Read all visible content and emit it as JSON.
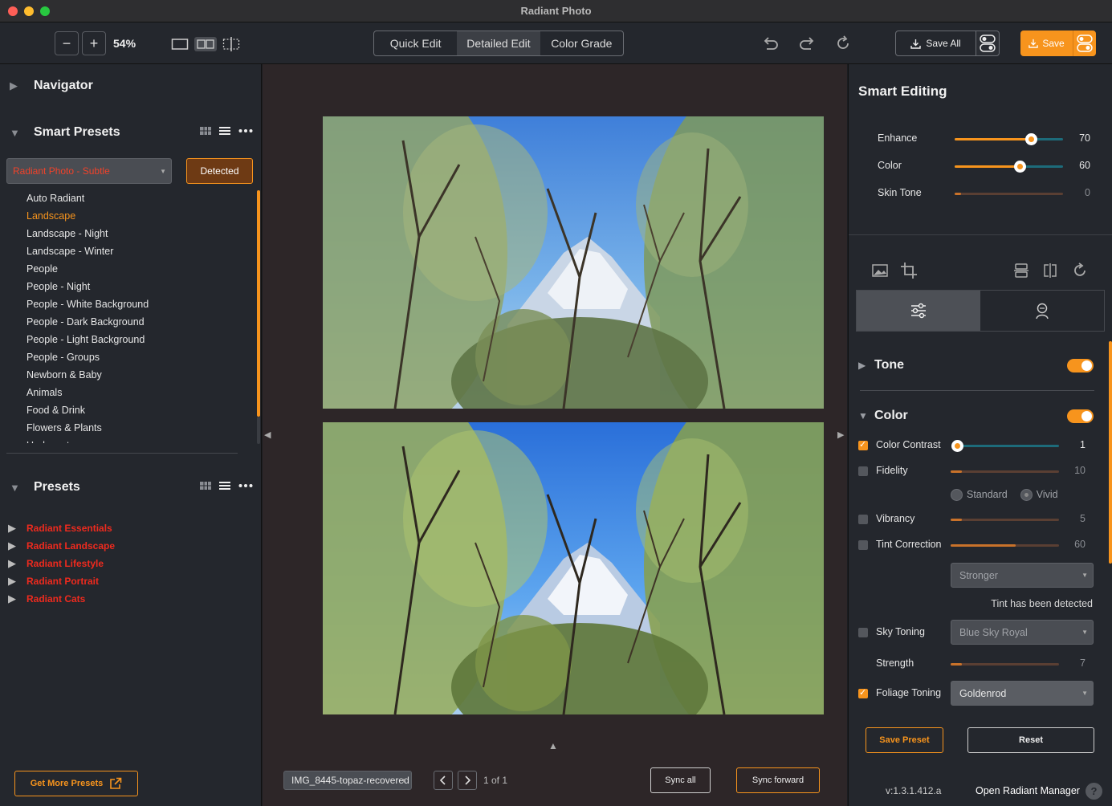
{
  "window": {
    "title": "Radiant Photo"
  },
  "toolbar": {
    "zoom_minus": "−",
    "zoom_plus": "+",
    "zoom": "54%",
    "modes": [
      "Quick Edit",
      "Detailed Edit",
      "Color Grade"
    ],
    "active_mode": "Detailed Edit",
    "save_all": "Save All",
    "save": "Save"
  },
  "left": {
    "navigator": "Navigator",
    "smart_presets": "Smart Presets",
    "selected_preset": "Radiant Photo - Subtle",
    "detected": "Detected",
    "smart_list": [
      "Auto Radiant",
      "Landscape",
      "Landscape - Night",
      "Landscape - Winter",
      "People",
      "People - Night",
      "People - White Background",
      "People - Dark Background",
      "People - Light Background",
      "People - Groups",
      "Newborn & Baby",
      "Animals",
      "Food & Drink",
      "Flowers & Plants",
      "Underwater"
    ],
    "presets": "Presets",
    "folders": [
      "Radiant Essentials",
      "Radiant Landscape",
      "Radiant Lifestyle",
      "Radiant Portrait",
      "Radiant Cats"
    ],
    "get_more": "Get More Presets"
  },
  "center": {
    "file_name": "IMG_8445-topaz-recovered",
    "page": "1 of 1",
    "sync_all": "Sync all",
    "sync_forward": "Sync forward"
  },
  "right": {
    "title": "Smart Editing",
    "smart_sliders": [
      {
        "label": "Enhance",
        "value": "70",
        "level": 0.7
      },
      {
        "label": "Color",
        "value": "60",
        "level": 0.6
      },
      {
        "label": "Skin Tone",
        "value": "0",
        "level": 0.0
      }
    ],
    "tone": "Tone",
    "color": "Color",
    "color_contrast": {
      "label": "Color Contrast",
      "value": "1",
      "level": 0.01
    },
    "fidelity": {
      "label": "Fidelity",
      "value": "10",
      "level": 0.1
    },
    "fidelity_modes": [
      "Standard",
      "Vivid"
    ],
    "vibrancy": {
      "label": "Vibrancy",
      "value": "5",
      "level": 0.05
    },
    "tint_correction": {
      "label": "Tint Correction",
      "value": "60",
      "level": 0.6
    },
    "tint_strength": "Stronger",
    "tint_note": "Tint has been detected",
    "sky_toning": {
      "label": "Sky Toning",
      "option": "Blue Sky Royal"
    },
    "strength": {
      "label": "Strength",
      "value": "7",
      "level": 0.07
    },
    "foliage_toning": {
      "label": "Foliage Toning",
      "option": "Goldenrod"
    },
    "save_preset": "Save Preset",
    "reset": "Reset",
    "version": "v:1.3.1.412.a",
    "open_manager": "Open Radiant Manager",
    "help": "?"
  },
  "colors": {
    "accent": "#f7941d",
    "preset_red": "#ee2a1e",
    "panel": "#24272d",
    "canvas": "#2d2628"
  }
}
